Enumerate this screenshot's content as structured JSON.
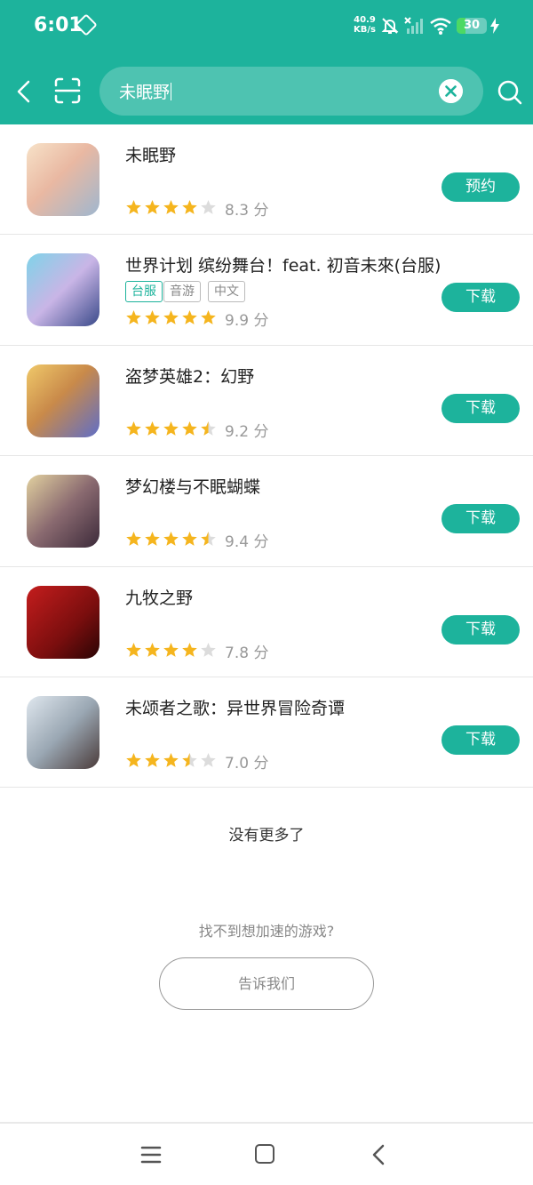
{
  "status_bar": {
    "time": "6:01",
    "net_speed_value": "40.9",
    "net_speed_unit": "KB/s",
    "battery": "30",
    "battery_level": 0.3
  },
  "search": {
    "query": "未眠野"
  },
  "games": [
    {
      "name": "未眠野",
      "tags": [],
      "rating": 4.0,
      "score": "8.3 分",
      "action": "预约"
    },
    {
      "name": "世界计划 缤纷舞台！feat. 初音未來(台服)",
      "tags": [
        "台服",
        "音游",
        "中文"
      ],
      "rating": 5.0,
      "score": "9.9 分",
      "action": "下载"
    },
    {
      "name": "盗梦英雄2：幻野",
      "tags": [],
      "rating": 4.5,
      "score": "9.2 分",
      "action": "下载"
    },
    {
      "name": "梦幻楼与不眠蝴蝶",
      "tags": [],
      "rating": 4.5,
      "score": "9.4 分",
      "action": "下载"
    },
    {
      "name": "九牧之野",
      "tags": [],
      "rating": 4.0,
      "score": "7.8 分",
      "action": "下载"
    },
    {
      "name": "未颂者之歌：异世界冒险奇谭",
      "tags": [],
      "rating": 3.5,
      "score": "7.0 分",
      "action": "下载"
    }
  ],
  "footer": {
    "no_more": "没有更多了",
    "cant_find": "找不到想加速的游戏?",
    "tell_us": "告诉我们"
  },
  "colors": {
    "accent": "#1db39c",
    "star_filled": "#f5b51e",
    "star_empty": "#dcdcdc",
    "tag_highlight": "#1db39c"
  },
  "icons": {
    "back": "chevron-left-icon",
    "scan": "scan-icon",
    "clear": "clear-icon",
    "search": "search-icon",
    "nav_menu": "menu-icon",
    "nav_home": "home-icon",
    "nav_back": "back-icon"
  }
}
